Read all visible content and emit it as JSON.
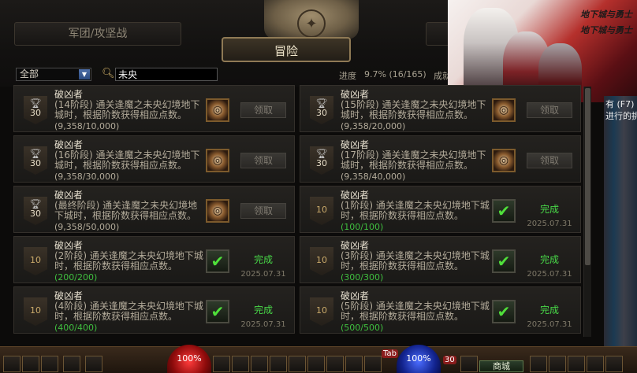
{
  "tabs": {
    "left": "军团/攻坚战",
    "right": "",
    "active": "冒险"
  },
  "filter": {
    "selected": "全部",
    "search_value": "未央"
  },
  "progress": {
    "label": "进度",
    "value": "9.7% (16/165)",
    "extra": "成就"
  },
  "promo": {
    "logo_text": "地下城与勇士"
  },
  "right_panel": {
    "line1": "有 (F7)",
    "line2": "进行的挑"
  },
  "actions": {
    "claim": "领取",
    "done": "完成"
  },
  "cards": [
    {
      "title": "破凶者",
      "desc": "(14阶段) 通关逢魔之未央幻境地下城时，根据阶数获得相应点数。",
      "progress": "(9,358/10,000)",
      "points": "30",
      "state": "claim"
    },
    {
      "title": "破凶者",
      "desc": "(15阶段) 通关逢魔之未央幻境地下城时，根据阶数获得相应点数。",
      "progress": "(9,358/20,000)",
      "points": "30",
      "state": "claim"
    },
    {
      "title": "破凶者",
      "desc": "(16阶段) 通关逢魔之未央幻境地下城时，根据阶数获得相应点数。",
      "progress": "(9,358/30,000)",
      "points": "30",
      "state": "claim"
    },
    {
      "title": "破凶者",
      "desc": "(17阶段) 通关逢魔之未央幻境地下城时，根据阶数获得相应点数。",
      "progress": "(9,358/40,000)",
      "points": "30",
      "state": "claim"
    },
    {
      "title": "破凶者",
      "desc": "(最终阶段) 通关逢魔之未央幻境地下城时，根据阶数获得相应点数。",
      "progress": "(9,358/50,000)",
      "points": "30",
      "state": "claim"
    },
    {
      "title": "破凶者",
      "desc": "(1阶段) 通关逢魔之未央幻境地下城时，根据阶数获得相应点数。",
      "progress": "(100/100)",
      "points": "10",
      "state": "done",
      "date": "2025.07.31"
    },
    {
      "title": "破凶者",
      "desc": "(2阶段) 通关逢魔之未央幻境地下城时，根据阶数获得相应点数。",
      "progress": "(200/200)",
      "points": "10",
      "state": "done",
      "date": "2025.07.31"
    },
    {
      "title": "破凶者",
      "desc": "(3阶段) 通关逢魔之未央幻境地下城时，根据阶数获得相应点数。",
      "progress": "(300/300)",
      "points": "10",
      "state": "done",
      "date": "2025.07.31"
    },
    {
      "title": "破凶者",
      "desc": "(4阶段) 通关逢魔之未央幻境地下城时，根据阶数获得相应点数。",
      "progress": "(400/400)",
      "points": "10",
      "state": "done",
      "date": "2025.07.31"
    },
    {
      "title": "破凶者",
      "desc": "(5阶段) 通关逢魔之未央幻境地下城时，根据阶数获得相应点数。",
      "progress": "(500/500)",
      "points": "10",
      "state": "done",
      "date": "2025.07.31"
    }
  ],
  "hud": {
    "hp": "100%",
    "mp": "100%",
    "shop": "商城",
    "tab_key": "Tab",
    "level_badge": "30"
  }
}
